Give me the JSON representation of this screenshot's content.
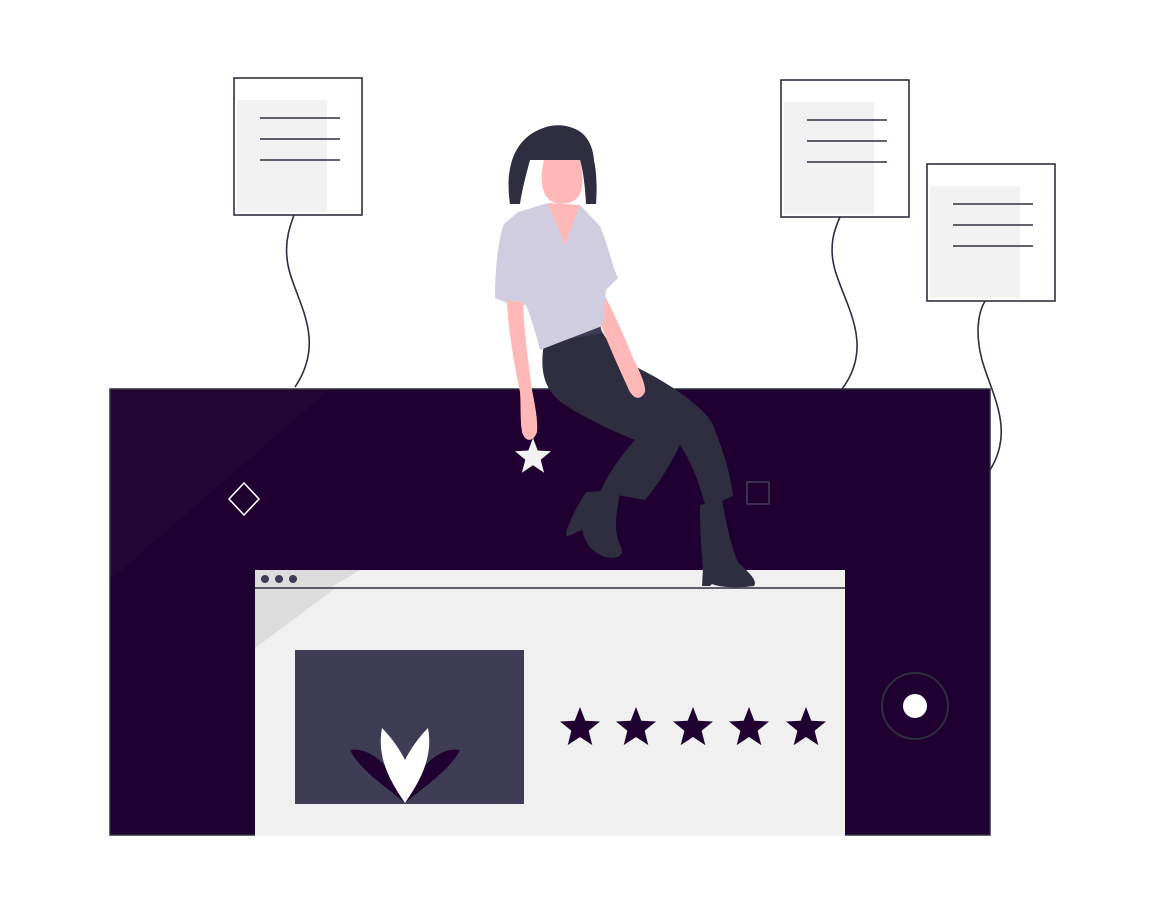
{
  "illustration": {
    "subject": "woman-sitting-on-phone-with-star-rating",
    "rating": {
      "stars_shown": 5,
      "max_stars": 5,
      "held_star": 1
    },
    "documents": [
      {
        "id": "doc-left",
        "text_lines": 3
      },
      {
        "id": "doc-right-top",
        "text_lines": 3
      },
      {
        "id": "doc-right-bottom",
        "text_lines": 3
      }
    ],
    "window_dots": 3,
    "colors": {
      "primary_dark": "#1f0030",
      "panel_dark": "#3f3d56",
      "screen_gray": "#f0f0f0",
      "skin": "#ffb8b8",
      "shirt": "#d0cde1",
      "pants": "#2f2e41",
      "hair": "#2f2e41",
      "paper": "#f2f2f2",
      "ink": "#2f2e41",
      "white": "#ffffff"
    },
    "icons": {
      "held": "star-icon",
      "rating": "star-icon",
      "product": "lotus-icon",
      "home_button": "circle-button-icon",
      "decor": [
        "diamond-outline-icon",
        "square-outline-icon"
      ]
    }
  }
}
